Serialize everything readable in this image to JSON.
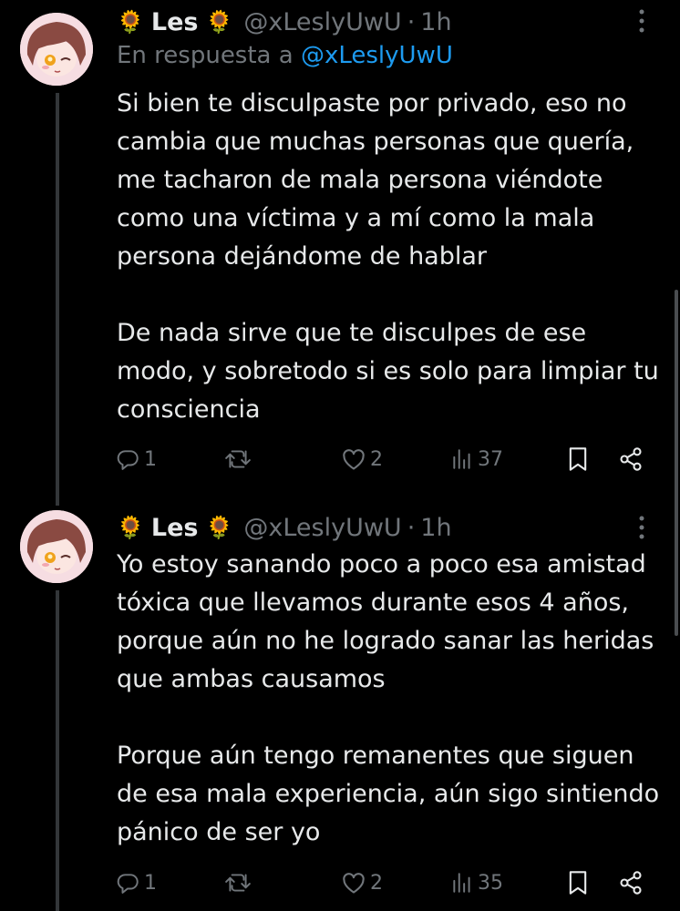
{
  "tweets": [
    {
      "author": {
        "name": "Les",
        "flower": "🌻",
        "handle": "@xLeslyUwU"
      },
      "separator": "·",
      "time": "1h",
      "reply": {
        "prefix": "En respuesta a",
        "mention": "@xLeslyUwU"
      },
      "paragraphs": [
        "Si bien te disculpaste por privado, eso no cambia que muchas personas que quería, me tacharon de mala persona viéndote como una víctima y a mí como la mala persona dejándome de hablar",
        "De nada sirve que te disculpes de ese modo, y sobretodo si es solo para limpiar tu consciencia"
      ],
      "stats": {
        "replies": "1",
        "retweets": "",
        "likes": "2",
        "views": "37"
      }
    },
    {
      "author": {
        "name": "Les",
        "flower": "🌻",
        "handle": "@xLeslyUwU"
      },
      "separator": "·",
      "time": "1h",
      "paragraphs": [
        "Yo estoy sanando poco a poco esa amistad tóxica que llevamos durante esos 4 años, porque aún no he logrado sanar las heridas que ambas causamos",
        "Porque aún tengo remanentes que siguen de esa mala experiencia, aún sigo sintiendo pánico de ser yo"
      ],
      "stats": {
        "replies": "1",
        "retweets": "",
        "likes": "2",
        "views": "35"
      }
    }
  ],
  "icons": {
    "reply": "reply-icon",
    "retweet": "retweet-icon",
    "like": "heart-icon",
    "views": "views-icon",
    "bookmark": "bookmark-icon",
    "share": "share-icon",
    "more": "more-icon"
  },
  "colors": {
    "background": "#000000",
    "text": "#e7e9ea",
    "muted": "#71767b",
    "link": "#1d9bf0",
    "thread_line": "#333639"
  }
}
